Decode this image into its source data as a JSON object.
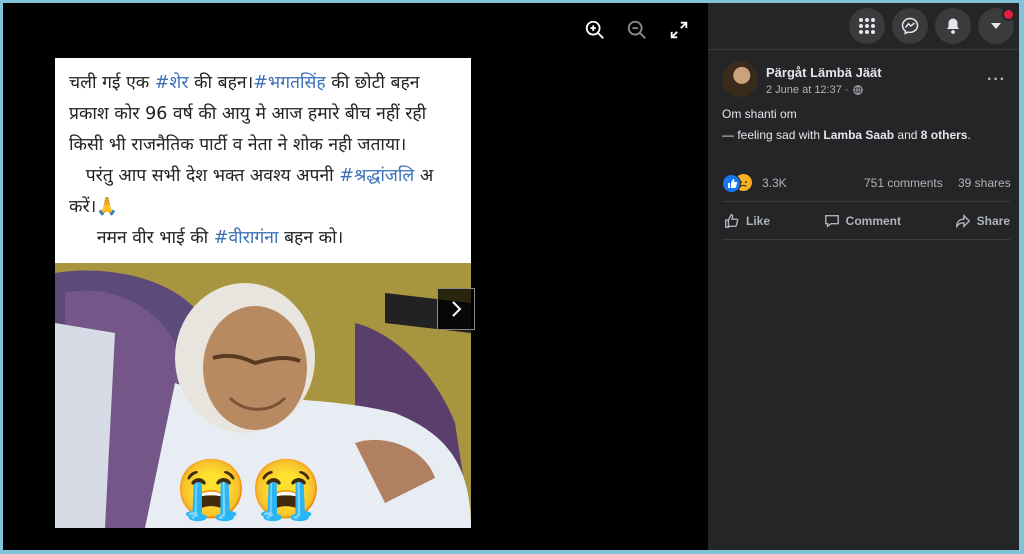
{
  "viewer": {
    "tools": [
      "zoom-in-icon",
      "zoom-out-icon",
      "fullscreen-icon"
    ],
    "photo": {
      "lines": [
        [
          {
            "t": "चली गई एक "
          },
          {
            "t": "#शेर",
            "tag": true
          },
          {
            "t": " की बहन।"
          },
          {
            "t": "#भगतसिंह",
            "tag": true
          },
          {
            "t": " की छोटी बहन"
          }
        ],
        [
          {
            "t": "प्रकाश कोर 96 वर्ष की आयु मे आज हमारे बीच नहीं रही"
          }
        ],
        [
          {
            "t": "किसी भी राजनैतिक पार्टी व नेता ने शोक नही जताया।"
          }
        ],
        [
          {
            "t": "   परंतु आप सभी देश भक्त अवश्य अपनी "
          },
          {
            "t": "#श्रद्धांजलि",
            "tag": true
          },
          {
            "t": " अ"
          }
        ],
        [
          {
            "t": "करें।🙏"
          }
        ],
        [
          {
            "t": "     नमन वीर भाई की "
          },
          {
            "t": "#वीरागंना",
            "tag": true
          },
          {
            "t": " बहन को।"
          }
        ]
      ],
      "emojis": [
        "😭",
        "😭"
      ]
    }
  },
  "panel": {
    "author": "Pärgåt Lämbä Jäät",
    "timestamp": "2 June at 12:37 ·",
    "caption": "Om shanti om",
    "feeling": {
      "prefix": "— feeling sad with ",
      "friend": "Lamba Saab",
      "mid": " and ",
      "others": "8 others",
      "suffix": "."
    },
    "reactions": {
      "count": "3.3K",
      "comments": "751 comments",
      "shares": "39 shares"
    },
    "actions": {
      "like": "Like",
      "comment": "Comment",
      "share": "Share"
    },
    "more": "···"
  },
  "colors": {
    "panel_bg": "#242526",
    "hashtag": "#3b6fb6",
    "like_blue": "#1877f2",
    "notif_red": "#e41e3f"
  }
}
